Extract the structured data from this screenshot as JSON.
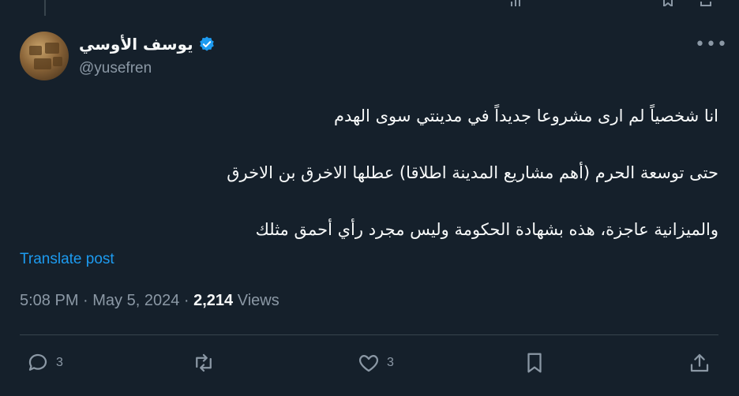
{
  "author": {
    "display_name": "يوسف الأوسي",
    "handle": "@yusefren",
    "verified": true
  },
  "tweet": {
    "lines": [
      "انا شخصياً لم ارى مشروعا جديداً في مدينتي سوى الهدم",
      "حتى توسعة الحرم (أهم مشاريع المدينة اطلاقا) عطلها الاخرق بن الاخرق",
      "والميزانية عاجزة، هذه بشهادة الحكومة وليس مجرد رأي أحمق مثلك"
    ],
    "translate_label": "Translate post",
    "time": "5:08 PM",
    "date": "May 5, 2024",
    "views_count": "2,214",
    "views_label": "Views"
  },
  "actions": {
    "reply_count": "3",
    "like_count": "3"
  },
  "colors": {
    "background": "#15202b",
    "text": "#f7f9f9",
    "muted": "#8b98a5",
    "accent": "#1d9bf0",
    "divider": "#38444d"
  },
  "icons": [
    "more-icon",
    "verified-badge-icon",
    "reply-icon",
    "retweet-icon",
    "like-icon",
    "bookmark-icon",
    "share-icon"
  ]
}
